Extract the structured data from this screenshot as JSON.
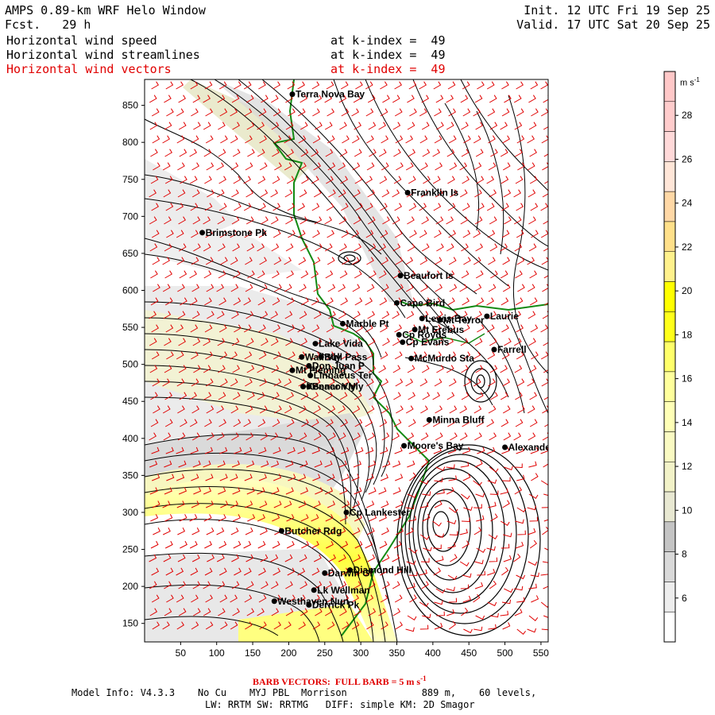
{
  "header": {
    "title": "AMPS 0.89-km WRF Helo Window",
    "fcst_label": "Fcst.",
    "fcst_value": "29 h",
    "init": "Init. 12 UTC Fri 19 Sep 25",
    "valid": "Valid. 17 UTC Sat 20 Sep 25",
    "fields": [
      {
        "name": "Horizontal wind speed",
        "level": "at k-index =  49",
        "color": "#000000"
      },
      {
        "name": "Horizontal wind streamlines",
        "level": "at k-index =  49",
        "color": "#000000"
      },
      {
        "name": "Horizontal wind vectors",
        "level": "at k-index =  49",
        "color": "#e00000"
      }
    ]
  },
  "map": {
    "x_ticks": [
      "50",
      "100",
      "150",
      "200",
      "250",
      "300",
      "350",
      "400",
      "450",
      "500",
      "550"
    ],
    "y_ticks": [
      "850",
      "800",
      "750",
      "700",
      "650",
      "600",
      "550",
      "500",
      "450",
      "400",
      "350",
      "300",
      "250",
      "200",
      "150"
    ],
    "x_range": [
      0,
      560
    ],
    "y_range": [
      125,
      885
    ],
    "places": [
      {
        "name": "Terra Nova Bay",
        "x": 205,
        "y": 865
      },
      {
        "name": "Franklin Is",
        "x": 365,
        "y": 732
      },
      {
        "name": "Brimstone Pk",
        "x": 80,
        "y": 678
      },
      {
        "name": "Beaufort Is",
        "x": 355,
        "y": 620
      },
      {
        "name": "Cape Bird",
        "x": 350,
        "y": 583
      },
      {
        "name": "Lewis Bay",
        "x": 385,
        "y": 562
      },
      {
        "name": "Mt Terror",
        "x": 410,
        "y": 560
      },
      {
        "name": "Laurie",
        "x": 475,
        "y": 565
      },
      {
        "name": "Marble Pt",
        "x": 275,
        "y": 555
      },
      {
        "name": "Cp Royds",
        "x": 353,
        "y": 540
      },
      {
        "name": "Mt Erebus",
        "x": 375,
        "y": 547
      },
      {
        "name": "Lake Vida",
        "x": 237,
        "y": 528
      },
      {
        "name": "Cp Evans",
        "x": 358,
        "y": 530
      },
      {
        "name": "Farrell",
        "x": 485,
        "y": 520
      },
      {
        "name": "Wall Vly",
        "x": 218,
        "y": 510
      },
      {
        "name": "Bull Pass",
        "x": 245,
        "y": 510
      },
      {
        "name": "McMurdo Sta",
        "x": 370,
        "y": 508
      },
      {
        "name": "Don Juan P",
        "x": 228,
        "y": 498
      },
      {
        "name": "Mt Fleming",
        "x": 205,
        "y": 492
      },
      {
        "name": "Linnaeus Ter",
        "x": 230,
        "y": 485
      },
      {
        "name": "Kennar Vly",
        "x": 220,
        "y": 470
      },
      {
        "name": "Beacon Vly",
        "x": 228,
        "y": 470
      },
      {
        "name": "Minna Bluff",
        "x": 395,
        "y": 425
      },
      {
        "name": "Moore's Bay",
        "x": 360,
        "y": 390
      },
      {
        "name": "Alexander",
        "x": 500,
        "y": 388
      },
      {
        "name": "Cp Lankester",
        "x": 280,
        "y": 300
      },
      {
        "name": "Butcher Rdg",
        "x": 190,
        "y": 275
      },
      {
        "name": "Darwin Gl",
        "x": 250,
        "y": 218
      },
      {
        "name": "Diamond Hill",
        "x": 285,
        "y": 222
      },
      {
        "name": "Lk Wellman",
        "x": 235,
        "y": 195
      },
      {
        "name": "Westhaven Nun",
        "x": 180,
        "y": 180
      },
      {
        "name": "Derrick Pk",
        "x": 228,
        "y": 175
      }
    ]
  },
  "colorbar": {
    "unit": "m s",
    "unit_exp": "-1",
    "labels": [
      "6",
      "8",
      "10",
      "12",
      "14",
      "16",
      "18",
      "20",
      "22",
      "24",
      "26",
      "28"
    ],
    "colors": [
      "#ffffff",
      "#ededed",
      "#d9d9d9",
      "#c4c4c4",
      "#e8e8d2",
      "#f2f2c8",
      "#fafac2",
      "#ffffb6",
      "#ffff9c",
      "#ffff6a",
      "#ffff1a",
      "#ffff00",
      "#fff18c",
      "#ffe08a",
      "#ffd8a6",
      "#ffe6d8",
      "#ffd9d9",
      "#ffcccc",
      "#ffc8c8"
    ]
  },
  "footer": {
    "barb_note": "BARB VECTORS:  FULL BARB = 5 m s",
    "barb_exp": "-1",
    "model_line": "Model Info: V4.3.3    No Cu    MYJ PBL  Morrison             889 m,    60 levels,",
    "physics_line": "LW: RRTM SW: RRTMG   DIFF: simple KM: 2D Smagor"
  }
}
